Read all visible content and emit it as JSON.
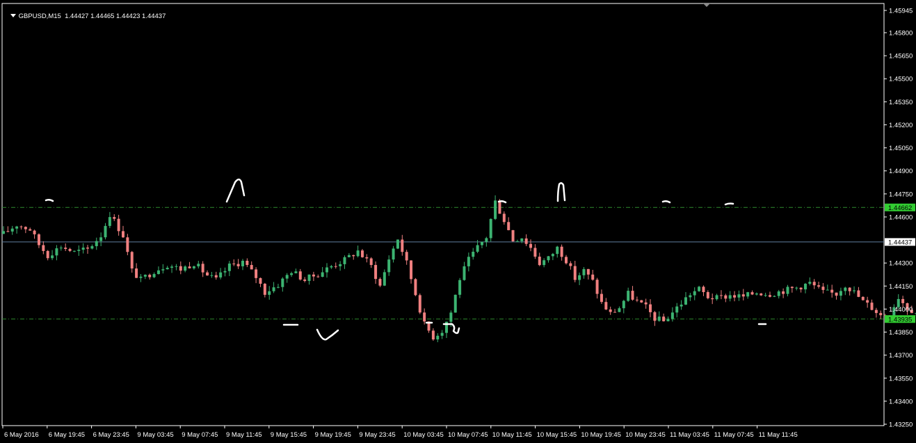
{
  "header": {
    "symbol": "GBPUSD,M15",
    "ohlc": "1.44427 1.44465 1.44423 1.44437"
  },
  "colors": {
    "background": "#000000",
    "frame": "#ffffff",
    "bull_candle": "#3cb371",
    "bear_candle": "#f08080",
    "level_line": "#2e8b2e",
    "bid_line": "#5f7f9f",
    "level_label_bg": "#32cd32",
    "bid_label_bg": "#ffffff"
  },
  "chart_data": {
    "type": "candlestick",
    "title": "GBPUSD,M15",
    "ylim": [
      1.4325,
      1.4602
    ],
    "y_ticks": [
      "1.45945",
      "1.45800",
      "1.45650",
      "1.45500",
      "1.45350",
      "1.45200",
      "1.45050",
      "1.44900",
      "1.44750",
      "1.44600",
      "1.44300",
      "1.44150",
      "1.44000",
      "1.43850",
      "1.43700",
      "1.43550",
      "1.43400",
      "1.43250"
    ],
    "x_ticks": [
      "6 May 2016",
      "6 May 19:45",
      "6 May 23:45",
      "9 May 03:45",
      "9 May 07:45",
      "9 May 11:45",
      "9 May 15:45",
      "9 May 19:45",
      "9 May 23:45",
      "10 May 03:45",
      "10 May 07:45",
      "10 May 11:45",
      "10 May 15:45",
      "10 May 19:45",
      "10 May 23:45",
      "11 May 03:45",
      "11 May 07:45",
      "11 May 11:45"
    ],
    "horizontal_levels": [
      {
        "label": "1.44662",
        "value": 1.44662
      },
      {
        "label": "1.43935",
        "value": 1.43935
      }
    ],
    "bid_line": {
      "label": "1.44437",
      "value": 1.44437
    },
    "close_path": [
      [
        0,
        1.4449
      ],
      [
        3,
        1.4455
      ],
      [
        6,
        1.4452
      ],
      [
        8,
        1.4442
      ],
      [
        10,
        1.4435
      ],
      [
        13,
        1.4441
      ],
      [
        16,
        1.4437
      ],
      [
        19,
        1.4439
      ],
      [
        22,
        1.4448
      ],
      [
        24,
        1.4462
      ],
      [
        27,
        1.4448
      ],
      [
        29,
        1.4425
      ],
      [
        31,
        1.4419
      ],
      [
        34,
        1.4425
      ],
      [
        37,
        1.4429
      ],
      [
        40,
        1.4426
      ],
      [
        43,
        1.443
      ],
      [
        46,
        1.4422
      ],
      [
        48,
        1.4419
      ],
      [
        51,
        1.4428
      ],
      [
        54,
        1.4431
      ],
      [
        57,
        1.4421
      ],
      [
        59,
        1.4411
      ],
      [
        62,
        1.4416
      ],
      [
        65,
        1.4425
      ],
      [
        68,
        1.4419
      ],
      [
        71,
        1.4423
      ],
      [
        74,
        1.4428
      ],
      [
        77,
        1.4432
      ],
      [
        80,
        1.4438
      ],
      [
        83,
        1.4428
      ],
      [
        85,
        1.4415
      ],
      [
        87,
        1.4433
      ],
      [
        89,
        1.4446
      ],
      [
        91,
        1.443
      ],
      [
        93,
        1.441
      ],
      [
        95,
        1.439
      ],
      [
        97,
        1.4382
      ],
      [
        99,
        1.4386
      ],
      [
        101,
        1.4398
      ],
      [
        103,
        1.442
      ],
      [
        105,
        1.4432
      ],
      [
        107,
        1.444
      ],
      [
        109,
        1.4447
      ],
      [
        111,
        1.447
      ],
      [
        113,
        1.4458
      ],
      [
        115,
        1.4445
      ],
      [
        117,
        1.4447
      ],
      [
        119,
        1.444
      ],
      [
        121,
        1.443
      ],
      [
        123,
        1.4433
      ],
      [
        125,
        1.444
      ],
      [
        127,
        1.4432
      ],
      [
        129,
        1.442
      ],
      [
        131,
        1.4425
      ],
      [
        133,
        1.4418
      ],
      [
        135,
        1.4404
      ],
      [
        137,
        1.4397
      ],
      [
        139,
        1.4401
      ],
      [
        141,
        1.441
      ],
      [
        143,
        1.4405
      ],
      [
        145,
        1.4401
      ],
      [
        147,
        1.4394
      ],
      [
        149,
        1.4392
      ],
      [
        151,
        1.4398
      ],
      [
        153,
        1.4404
      ],
      [
        155,
        1.441
      ],
      [
        157,
        1.4413
      ],
      [
        159,
        1.4408
      ],
      [
        161,
        1.4407
      ],
      [
        164,
        1.4409
      ],
      [
        167,
        1.4408
      ],
      [
        170,
        1.4411
      ],
      [
        173,
        1.441
      ],
      [
        176,
        1.4412
      ],
      [
        179,
        1.4414
      ],
      [
        182,
        1.4417
      ],
      [
        185,
        1.4411
      ],
      [
        188,
        1.441
      ],
      [
        190,
        1.4416
      ],
      [
        192,
        1.4411
      ],
      [
        194,
        1.4405
      ],
      [
        196,
        1.4401
      ],
      [
        198,
        1.4396
      ],
      [
        200,
        1.4397
      ],
      [
        202,
        1.4408
      ],
      [
        204,
        1.4401
      ],
      [
        206,
        1.4398
      ],
      [
        208,
        1.4396
      ],
      [
        210,
        1.4398
      ],
      [
        212,
        1.4405
      ],
      [
        214,
        1.4412
      ],
      [
        216,
        1.4421
      ],
      [
        218,
        1.4432
      ],
      [
        220,
        1.4436
      ],
      [
        222,
        1.4426
      ],
      [
        224,
        1.4431
      ],
      [
        226,
        1.4438
      ],
      [
        228,
        1.4447
      ],
      [
        230,
        1.4456
      ],
      [
        232,
        1.4441
      ],
      [
        234,
        1.4432
      ],
      [
        236,
        1.4428
      ],
      [
        238,
        1.4431
      ],
      [
        240,
        1.4438
      ],
      [
        242,
        1.443
      ],
      [
        244,
        1.4426
      ],
      [
        246,
        1.4433
      ],
      [
        248,
        1.444
      ],
      [
        250,
        1.445
      ],
      [
        252,
        1.4458
      ],
      [
        254,
        1.4463
      ],
      [
        256,
        1.4452
      ],
      [
        258,
        1.4445
      ],
      [
        260,
        1.444
      ],
      [
        262,
        1.4437
      ],
      [
        264,
        1.4431
      ],
      [
        266,
        1.4428
      ],
      [
        269,
        1.4433
      ],
      [
        272,
        1.4434
      ],
      [
        275,
        1.4432
      ],
      [
        278,
        1.4437
      ],
      [
        281,
        1.444
      ],
      [
        284,
        1.4442
      ],
      [
        287,
        1.444
      ],
      [
        290,
        1.4441
      ],
      [
        293,
        1.4444
      ],
      [
        296,
        1.4446
      ],
      [
        299,
        1.4446
      ],
      [
        302,
        1.445
      ],
      [
        304,
        1.4462
      ],
      [
        306,
        1.4455
      ],
      [
        308,
        1.445
      ],
      [
        311,
        1.4447
      ],
      [
        314,
        1.4444
      ],
      [
        317,
        1.4444
      ],
      [
        320,
        1.4443
      ],
      [
        323,
        1.4441
      ],
      [
        326,
        1.4445
      ],
      [
        329,
        1.4448
      ],
      [
        331,
        1.4456
      ],
      [
        333,
        1.4462
      ],
      [
        335,
        1.4456
      ],
      [
        337,
        1.444
      ],
      [
        339,
        1.4432
      ],
      [
        341,
        1.4428
      ],
      [
        343,
        1.4431
      ],
      [
        345,
        1.442
      ],
      [
        347,
        1.4405
      ],
      [
        349,
        1.4398
      ],
      [
        351,
        1.441
      ],
      [
        353,
        1.4418
      ],
      [
        355,
        1.4426
      ],
      [
        357,
        1.4431
      ],
      [
        359,
        1.442
      ],
      [
        361,
        1.4426
      ],
      [
        363,
        1.4432
      ],
      [
        365,
        1.4441
      ],
      [
        367,
        1.4444
      ]
    ],
    "annotations": "white hand-drawn marks at swing highs and lows"
  }
}
